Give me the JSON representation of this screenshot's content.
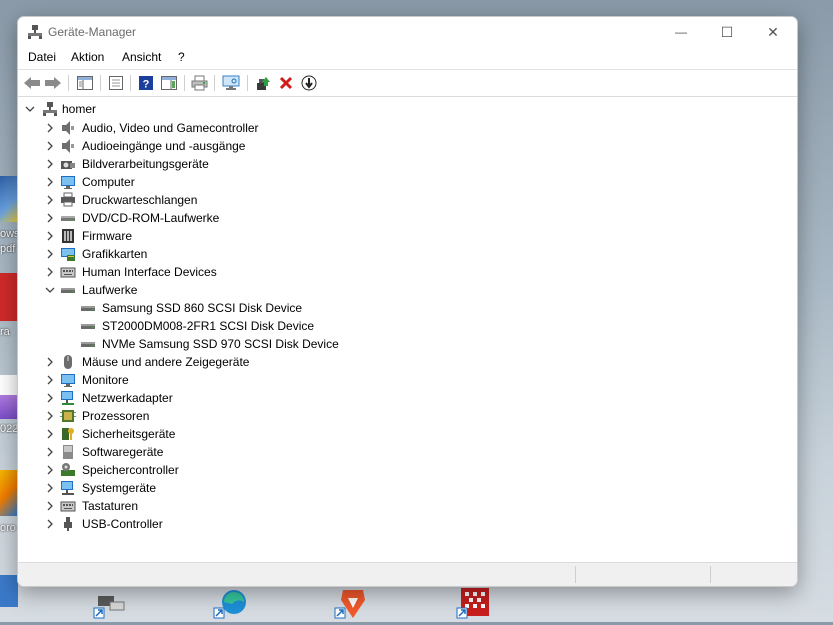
{
  "window": {
    "title": "Geräte-Manager",
    "minimize_glyph": "—",
    "maximize_glyph": "☐",
    "close_glyph": "✕"
  },
  "menu": [
    "Datei",
    "Aktion",
    "Ansicht",
    "?"
  ],
  "toolbar_icons": [
    "back-arrow-icon",
    "forward-arrow-icon",
    "show-hide-console-tree-icon",
    "properties-sheet-icon",
    "help-icon",
    "action-pane-icon",
    "print-icon",
    "scan-hardware-icon",
    "update-driver-icon",
    "uninstall-device-icon",
    "disable-device-icon"
  ],
  "tree": {
    "root": "homer",
    "categories": [
      {
        "label": "Audio, Video und Gamecontroller",
        "icon": "speaker-icon",
        "expanded": false
      },
      {
        "label": "Audioeingänge und -ausgänge",
        "icon": "speaker-icon",
        "expanded": false
      },
      {
        "label": "Bildverarbeitungsgeräte",
        "icon": "camera-icon",
        "expanded": false
      },
      {
        "label": "Computer",
        "icon": "monitor-icon",
        "expanded": false
      },
      {
        "label": "Druckwarteschlangen",
        "icon": "printer-icon",
        "expanded": false
      },
      {
        "label": "DVD/CD-ROM-Laufwerke",
        "icon": "optical-drive-icon",
        "expanded": false
      },
      {
        "label": "Firmware",
        "icon": "chip-icon",
        "expanded": false
      },
      {
        "label": "Grafikkarten",
        "icon": "display-adapter-icon",
        "expanded": false
      },
      {
        "label": "Human Interface Devices",
        "icon": "keyboard-icon",
        "expanded": false
      },
      {
        "label": "Laufwerke",
        "icon": "disk-drive-icon",
        "expanded": true,
        "children": [
          "Samsung SSD 860 SCSI Disk Device",
          "ST2000DM008-2FR1 SCSI Disk Device",
          "NVMe Samsung SSD 970 SCSI Disk Device"
        ]
      },
      {
        "label": "Mäuse und andere Zeigegeräte",
        "icon": "mouse-icon",
        "expanded": false
      },
      {
        "label": "Monitore",
        "icon": "monitor-icon",
        "expanded": false
      },
      {
        "label": "Netzwerkadapter",
        "icon": "network-adapter-icon",
        "expanded": false
      },
      {
        "label": "Prozessoren",
        "icon": "processor-icon",
        "expanded": false
      },
      {
        "label": "Sicherheitsgeräte",
        "icon": "security-key-icon",
        "expanded": false
      },
      {
        "label": "Softwaregeräte",
        "icon": "software-device-icon",
        "expanded": false
      },
      {
        "label": "Speichercontroller",
        "icon": "storage-controller-icon",
        "expanded": false
      },
      {
        "label": "Systemgeräte",
        "icon": "system-device-icon",
        "expanded": false
      },
      {
        "label": "Tastaturen",
        "icon": "keyboard-icon",
        "expanded": false
      },
      {
        "label": "USB-Controller",
        "icon": "usb-icon",
        "expanded": false
      }
    ]
  },
  "desktop": {
    "partial_labels": [
      "ows",
      "pdf",
      "ra",
      "022",
      "oro"
    ]
  },
  "colors": {
    "accent_blue": "#1c6fc4",
    "uninstall_red": "#d11a1a",
    "help_blue": "#1b3f9a"
  }
}
